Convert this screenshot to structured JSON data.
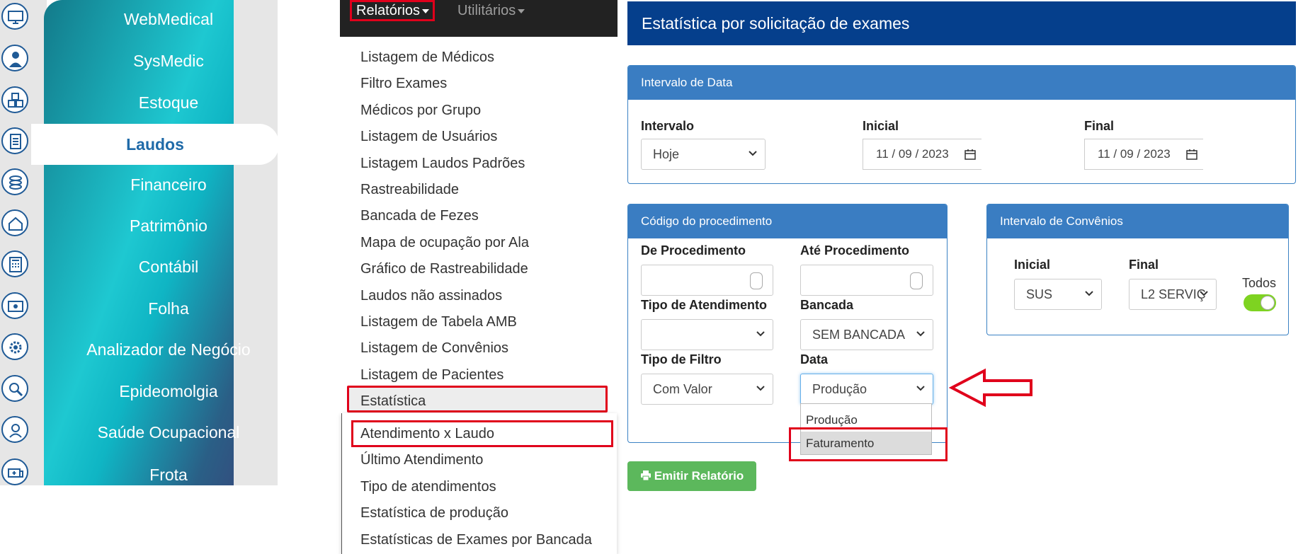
{
  "modules": [
    {
      "label": "WebMedical",
      "icon": "monitor-icon"
    },
    {
      "label": "SysMedic",
      "icon": "doctor-icon"
    },
    {
      "label": "Estoque",
      "icon": "boxes-icon"
    },
    {
      "label": "Laudos",
      "icon": "document-icon",
      "active": true
    },
    {
      "label": "Financeiro",
      "icon": "coins-icon"
    },
    {
      "label": "Patrimônio",
      "icon": "house-hand-icon"
    },
    {
      "label": "Contábil",
      "icon": "calculator-icon"
    },
    {
      "label": "Folha",
      "icon": "payroll-icon"
    },
    {
      "label": "Analizador de Negócio",
      "icon": "gear-chart-icon"
    },
    {
      "label": "Epideomolgia",
      "icon": "magnifier-virus-icon"
    },
    {
      "label": "Saúde Ocupacional",
      "icon": "worker-icon"
    },
    {
      "label": "Frota",
      "icon": "ambulance-icon"
    }
  ],
  "nav": {
    "relatorios": "Relatórios",
    "utilitarios": "Utilitários"
  },
  "menu": [
    "Listagem de Médicos",
    "Filtro Exames",
    "Médicos por Grupo",
    "Listagem de Usuários",
    "Listagem Laudos Padrões",
    "Rastreabilidade",
    "Bancada de Fezes",
    "Mapa de ocupação por Ala",
    "Gráfico de Rastreabilidade",
    "Laudos não assinados",
    "Listagem de Tabela AMB",
    "Listagem de Convênios",
    "Listagem de Pacientes",
    "Estatística"
  ],
  "submenu": [
    "Atendimento x Laudo",
    "Último Atendimento",
    "Tipo de atendimentos",
    "Estatística de produção",
    "Estatísticas de Exames por Bancada"
  ],
  "form": {
    "title": "Estatística por solicitação de exames",
    "interval_panel": {
      "header": "Intervalo de Data",
      "intervalo_label": "Intervalo",
      "intervalo_value": "Hoje",
      "inicial_label": "Inicial",
      "inicial_value": "11 / 09 / 2023",
      "final_label": "Final",
      "final_value": "11 / 09 / 2023"
    },
    "proc_panel": {
      "header": "Código do procedimento",
      "de_label": "De Procedimento",
      "ate_label": "Até Procedimento",
      "tipo_atend_label": "Tipo de Atendimento",
      "tipo_atend_value": "",
      "bancada_label": "Bancada",
      "bancada_value": "SEM BANCADA",
      "tipo_filtro_label": "Tipo de Filtro",
      "tipo_filtro_value": "Com Valor",
      "data_label": "Data",
      "data_value": "Produção",
      "data_options": [
        "Produção",
        "Faturamento"
      ]
    },
    "conv_panel": {
      "header": "Intervalo de Convênios",
      "inicial_label": "Inicial",
      "inicial_value": "SUS",
      "final_label": "Final",
      "final_value": "L2 SERVIÇ",
      "todos_label": "Todos",
      "todos_on": true
    },
    "emit_label": "Emitir Relatório"
  },
  "colors": {
    "header": "#053f8c",
    "panel": "#3a7dc2",
    "highlight": "#e0001b",
    "success": "#5cb85c"
  }
}
